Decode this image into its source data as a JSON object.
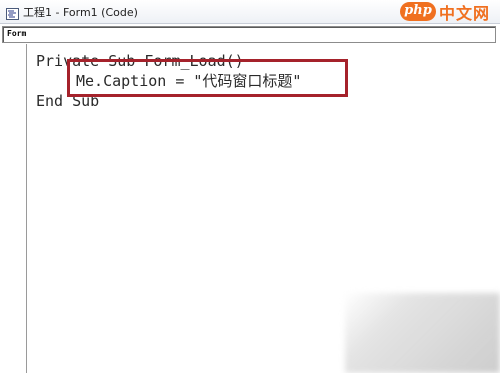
{
  "window": {
    "title": "工程1 - Form1 (Code)",
    "icon": "code-window-icon"
  },
  "watermark": {
    "logo": "php",
    "text": "中文网",
    "color": "#f07020"
  },
  "object_selector": {
    "value": "Form"
  },
  "code": {
    "lines": [
      "Private Sub Form_Load()",
      "Me.Caption = \"代码窗口标题\"",
      "End Sub"
    ]
  },
  "highlight": {
    "color": "#a5222b"
  }
}
